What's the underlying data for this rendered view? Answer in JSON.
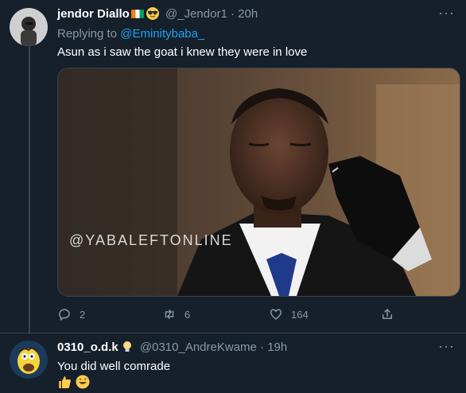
{
  "tweet1": {
    "display_name": "jendor Diallo",
    "handle": "@_Jendor1",
    "separator": "·",
    "time": "20h",
    "replying_prefix": "Replying to",
    "replying_handle": "@Eminitybaba_",
    "text": "Asun as i saw the goat i knew they were in love",
    "media_watermark": "@YABALEFTONLINE",
    "reply_count": "2",
    "retweet_count": "6",
    "like_count": "164"
  },
  "tweet2": {
    "display_name": "0310_o.d.k",
    "handle": "@0310_AndreKwame",
    "separator": "·",
    "time": "19h",
    "text": "You did well comrade"
  },
  "more_label": "···",
  "colors": {
    "background": "#15202b",
    "muted": "#8899a6",
    "link": "#1da1f2",
    "divider": "#38444d"
  }
}
